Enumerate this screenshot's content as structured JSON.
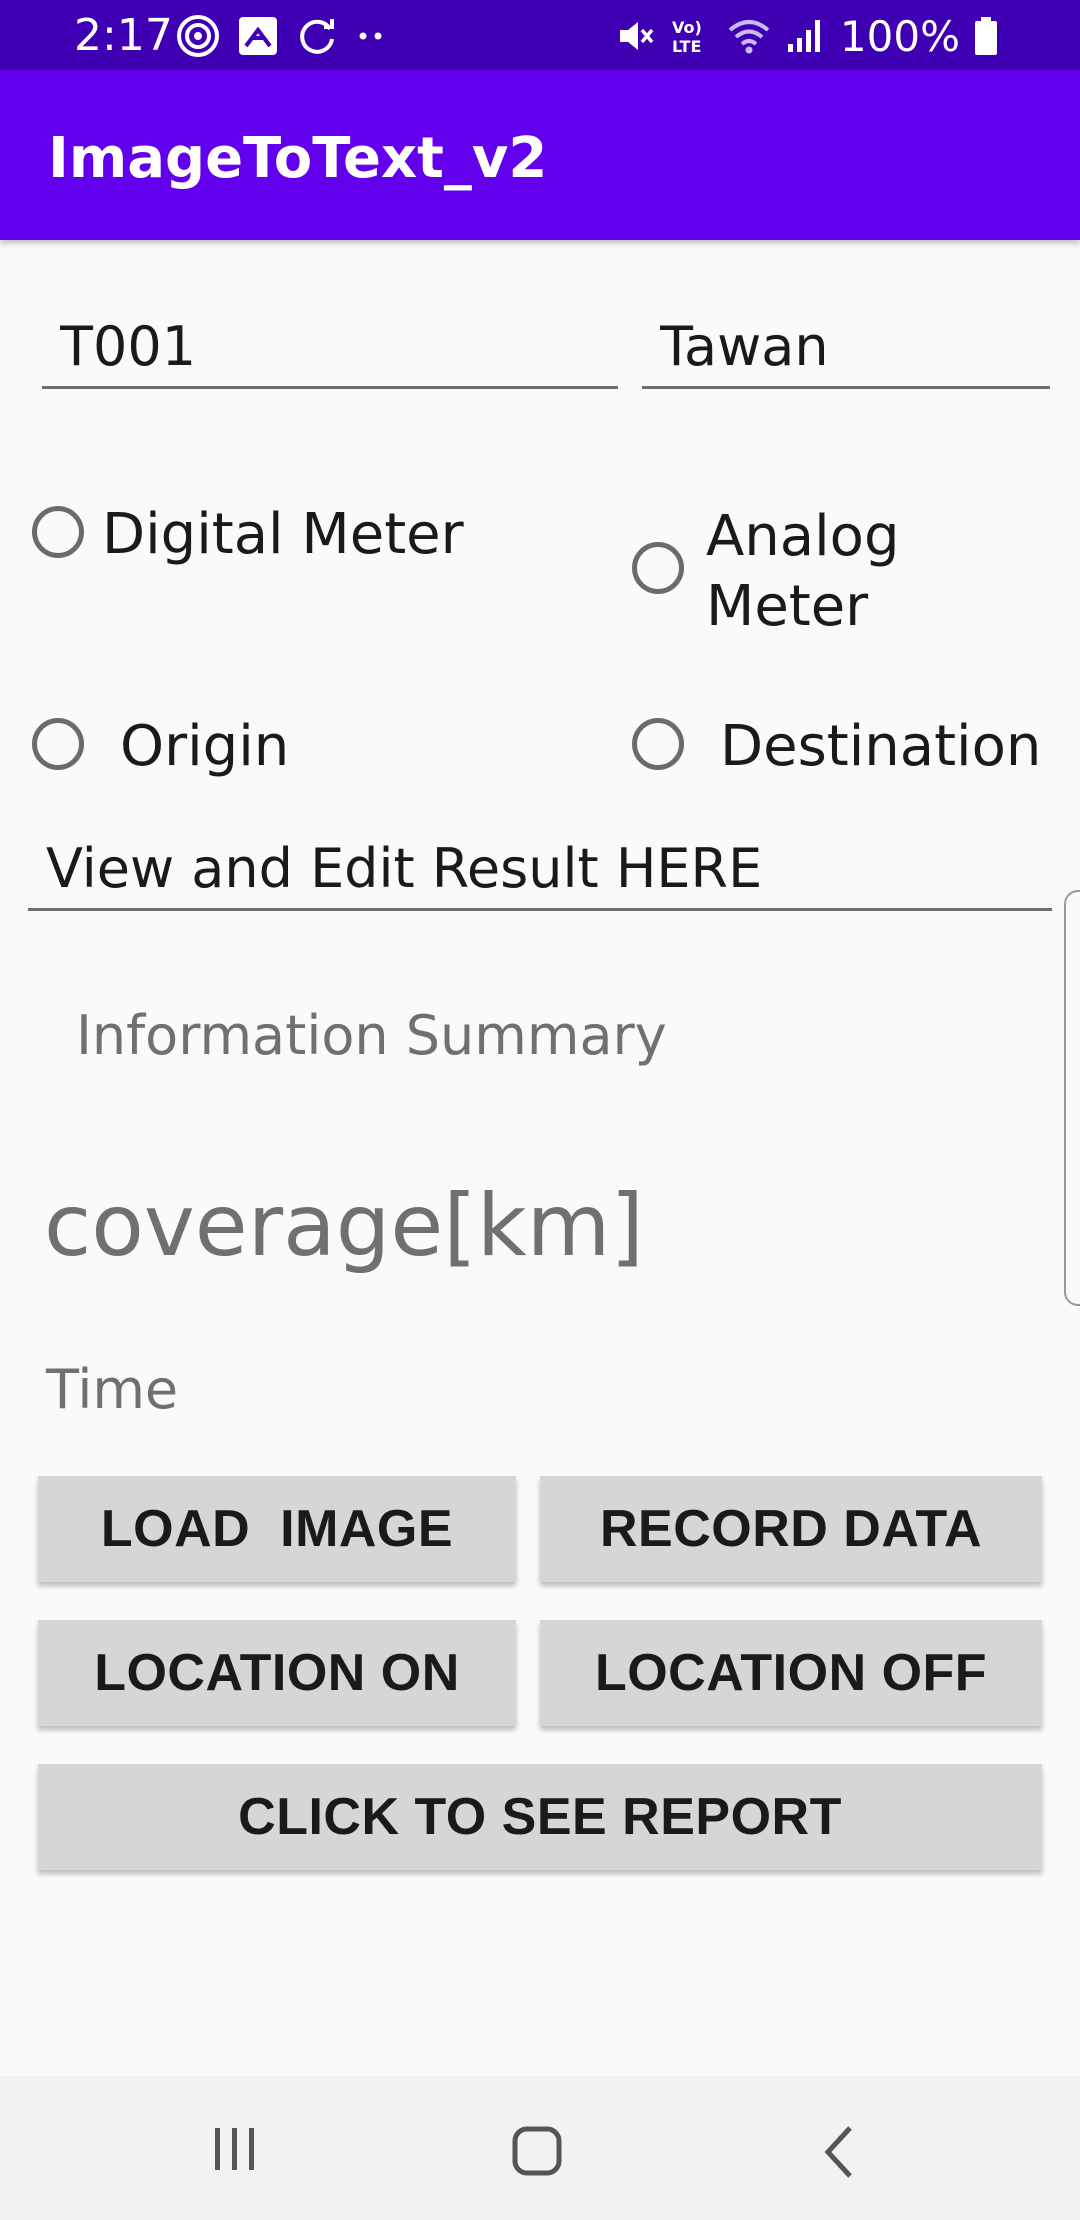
{
  "status_bar": {
    "time": "2:17",
    "battery": "100%",
    "icons": [
      "target-icon",
      "app-icon",
      "sync-icon",
      "more-dots-icon",
      "mute-icon",
      "volte-icon",
      "wifi-icon",
      "signal-icon",
      "battery-icon"
    ]
  },
  "app_bar": {
    "title": "ImageToText_v2"
  },
  "form": {
    "id_value": "T001",
    "name_value": "Tawan",
    "meter_options": [
      "Digital Meter",
      "Analog Meter"
    ],
    "direction_options": [
      "Origin",
      "Destination"
    ],
    "result_placeholder": "View and Edit Result HERE",
    "info_summary": "Information Summary",
    "coverage": "coverage[km]",
    "time_label": "Time"
  },
  "buttons": {
    "load_image": "LOAD  IMAGE",
    "record_data": "RECORD DATA",
    "location_on": "LOCATION ON",
    "location_off": "LOCATION OFF",
    "report": "CLICK TO SEE REPORT"
  },
  "nav_bar": {
    "icons": [
      "recent-apps-icon",
      "home-icon",
      "back-icon"
    ]
  },
  "colors": {
    "status_bar": "#3f00b3",
    "app_bar": "#6200ee",
    "button": "#d6d6d6"
  }
}
